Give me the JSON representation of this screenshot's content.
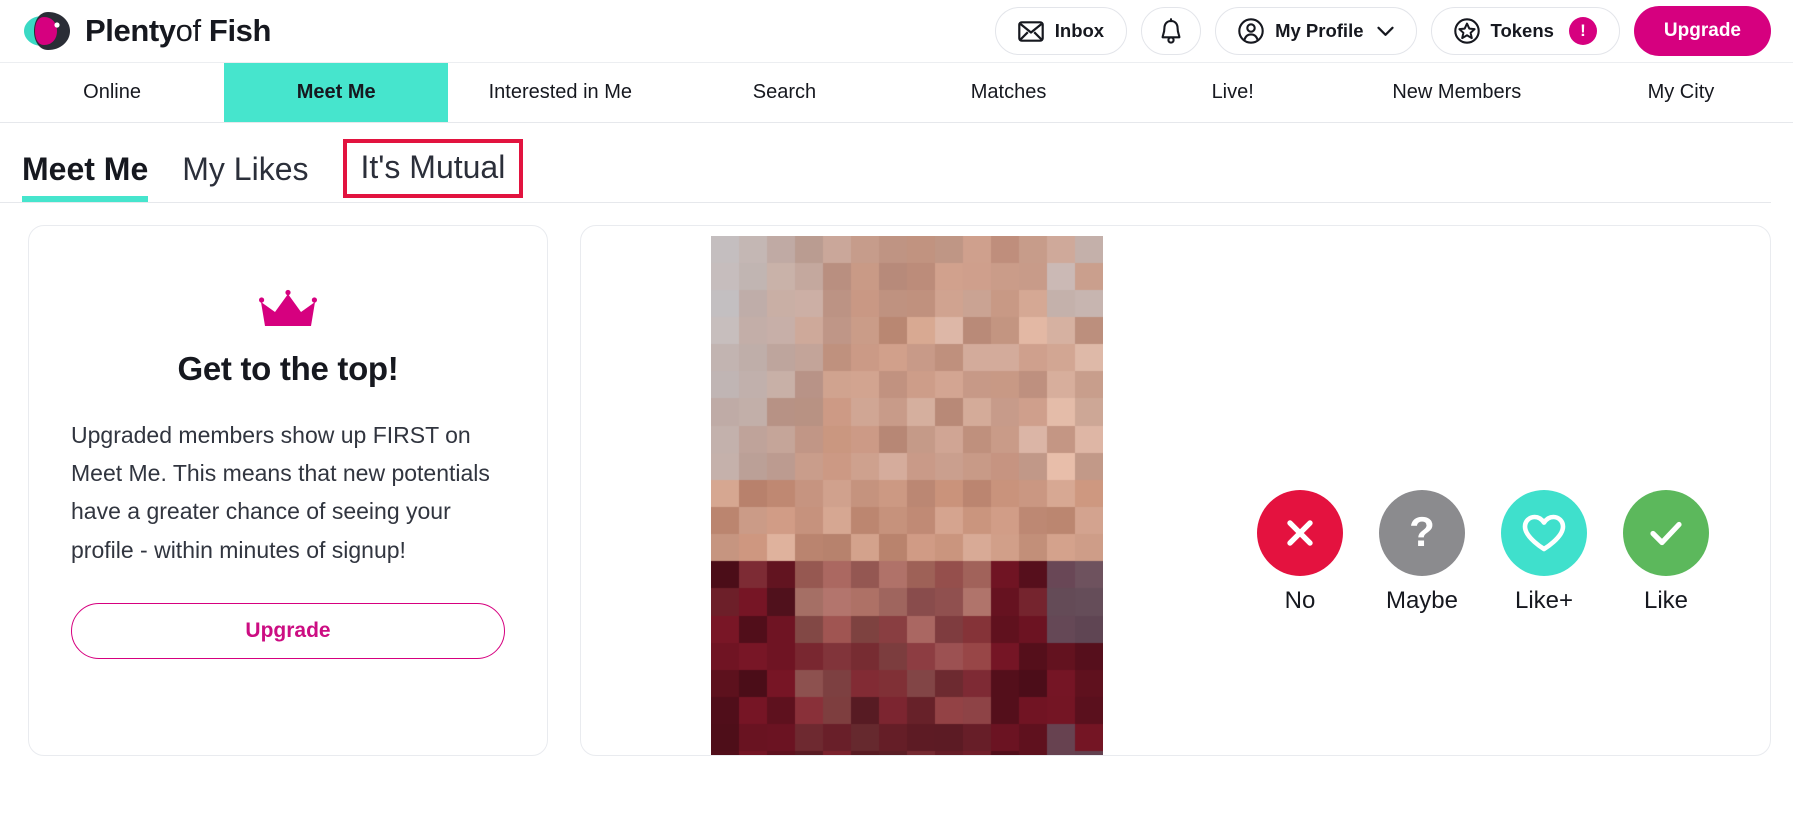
{
  "brand": {
    "name_part1": "Plenty",
    "name_part2": "of",
    "name_part3": "Fish",
    "logo_icon": "fish-logo-icon",
    "colors": {
      "teal": "#46e5cd",
      "magenta": "#d6007f",
      "dark": "#2a2d36"
    }
  },
  "header": {
    "inbox_label": "Inbox",
    "inbox_icon": "envelope-icon",
    "notifications_icon": "bell-icon",
    "profile_label": "My Profile",
    "profile_icon": "user-circle-icon",
    "profile_chevron_icon": "chevron-down-icon",
    "tokens_label": "Tokens",
    "tokens_icon": "star-circle-icon",
    "tokens_badge": "!",
    "upgrade_label": "Upgrade"
  },
  "mainnav": {
    "items": [
      {
        "label": "Online",
        "active": false
      },
      {
        "label": "Meet Me",
        "active": true
      },
      {
        "label": "Interested in Me",
        "active": false
      },
      {
        "label": "Search",
        "active": false
      },
      {
        "label": "Matches",
        "active": false
      },
      {
        "label": "Live!",
        "active": false
      },
      {
        "label": "New Members",
        "active": false
      },
      {
        "label": "My City",
        "active": false
      }
    ]
  },
  "subtabs": {
    "items": [
      {
        "label": "Meet Me",
        "active": true,
        "highlighted": false
      },
      {
        "label": "My Likes",
        "active": false,
        "highlighted": false
      },
      {
        "label": "It's Mutual",
        "active": false,
        "highlighted": true
      }
    ],
    "highlight_color": "#e2133f"
  },
  "promo": {
    "crown_icon": "crown-icon",
    "title": "Get to the top!",
    "body": "Upgraded members show up FIRST on Meet Me. This means that new potentials have a greater chance of seeing your profile - within minutes of signup!",
    "upgrade_label": "Upgrade"
  },
  "profile": {
    "photo_alt": "pixelated-profile-photo",
    "actions": [
      {
        "label": "No",
        "icon": "x-icon",
        "color": "#e4123f"
      },
      {
        "label": "Maybe",
        "icon": "question-icon",
        "color": "#8b8b8e"
      },
      {
        "label": "Like+",
        "icon": "heart-outline-icon",
        "color": "#3fe0cc"
      },
      {
        "label": "Like",
        "icon": "check-icon",
        "color": "#5cb85c"
      }
    ]
  }
}
